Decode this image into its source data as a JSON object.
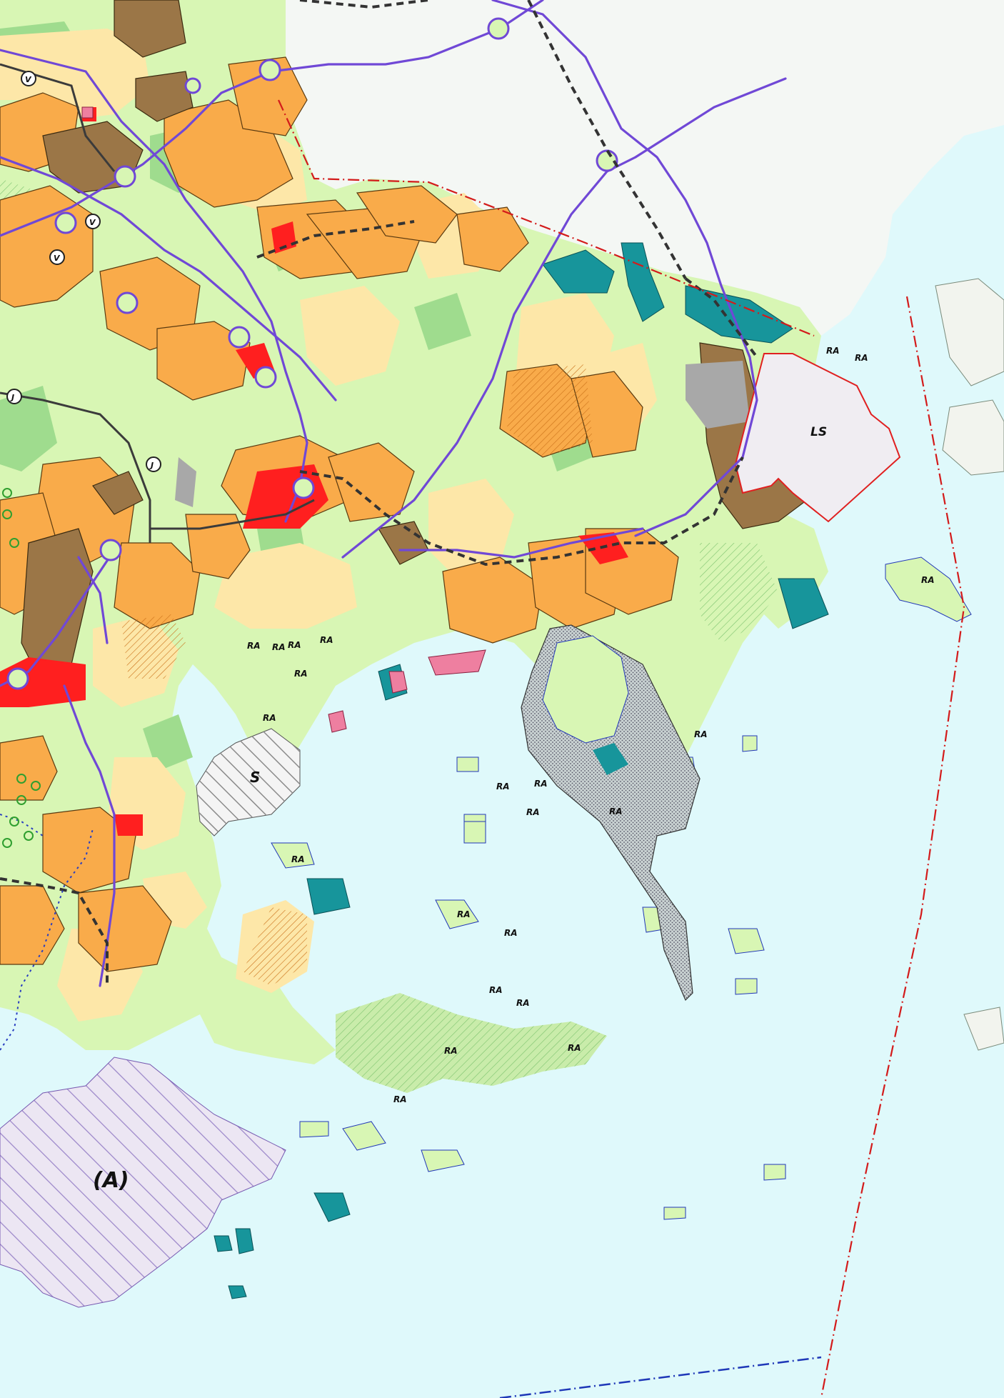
{
  "map": {
    "colors": {
      "sea": "#dff9fb",
      "coastal_strip": "#f4f7f4",
      "green_area": "#d8f6b4",
      "green_mid": "#9fdc8e",
      "residential_light": "#fde7a8",
      "residential": "#f9ab4a",
      "industrial": "#9b7647",
      "centre": "#ff1f1f",
      "teal_protection": "#17959b",
      "pink_area": "#ee7fa0",
      "grey_area": "#a8a8a8",
      "harbour_zone": "#f0edf2",
      "harbour_outline": "#e02020",
      "main_road": "#7048d6",
      "rail": "#444444",
      "boundary": "#d31b1b",
      "water_border": "#1f38b8",
      "protected_area_fill": "#9aa8a8",
      "restricted_hatch": "#b49cd8"
    },
    "labels": {
      "ls": "LS",
      "s": "S",
      "a": "(A)",
      "ra": "RA",
      "v": "V",
      "j": "J"
    }
  }
}
